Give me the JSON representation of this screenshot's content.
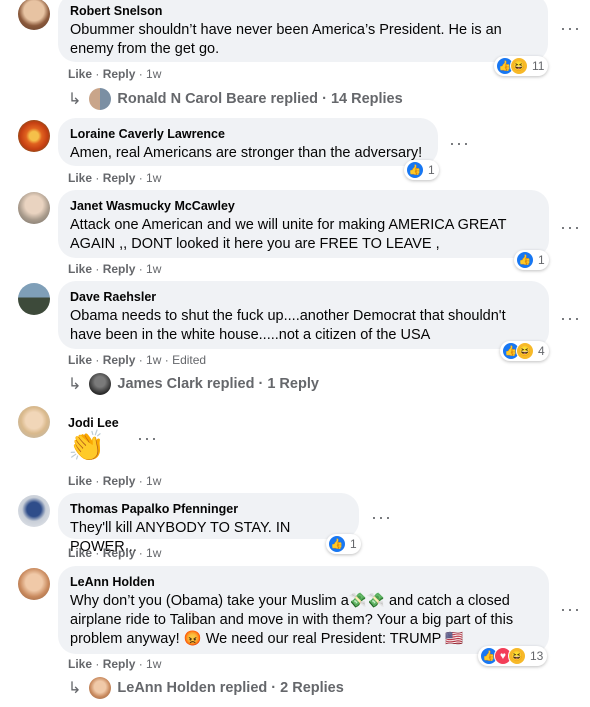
{
  "comments": [
    {
      "author": "Robert Snelson",
      "text": "Obummer shouldn’t have never been America’s President. He is an enemy from the get go.",
      "like": "Like",
      "reply": "Reply",
      "time": "1w",
      "reaction_count": "11",
      "replies": {
        "name": "Ronald N Carol Beare replied",
        "count": "14 Replies"
      }
    },
    {
      "author": "Loraine Caverly Lawrence",
      "text": "Amen, real Americans are stronger than the adversary!",
      "like": "Like",
      "reply": "Reply",
      "time": "1w",
      "reaction_count": "1"
    },
    {
      "author": "Janet Wasmucky McCawley",
      "text": "Attack one American and we will unite for making AMERICA GREAT AGAIN ,, DONT looked it here you are FREE TO LEAVE ,",
      "like": "Like",
      "reply": "Reply",
      "time": "1w",
      "reaction_count": "1"
    },
    {
      "author": "Dave Raehsler",
      "text": "Obama needs to shut the fuck up....another Democrat that shouldn't have been in the white house.....not a citizen of the USA",
      "like": "Like",
      "reply": "Reply",
      "time": "1w",
      "edited": "Edited",
      "reaction_count": "4",
      "replies": {
        "name": "James Clark replied",
        "count": "1 Reply"
      }
    },
    {
      "author": "Jodi Lee",
      "text": "👏",
      "like": "Like",
      "reply": "Reply",
      "time": "1w"
    },
    {
      "author": "Thomas Papalko Pfenninger",
      "text": "They'll kill ANYBODY TO STAY. IN POWER...",
      "like": "Like",
      "reply": "Reply",
      "time": "1w",
      "reaction_count": "1"
    },
    {
      "author": "LeAnn Holden",
      "text": "Why don’t you (Obama) take your Muslim a💸💸 and catch a closed airplane ride to Taliban and move in with them? Your a big part of this problem anyway! 😡 We need our real President: TRUMP 🇺🇸",
      "like": "Like",
      "reply": "Reply",
      "time": "1w",
      "reaction_count": "13",
      "replies": {
        "name": "LeAnn Holden replied",
        "count": "2 Replies"
      }
    }
  ],
  "colors": {
    "bubble": "#f0f2f5",
    "meta": "#65676b",
    "like_blue": "#1877f2",
    "haha_yellow": "#f7b928",
    "love_red": "#f33e58"
  },
  "icons": {
    "more": "more-dots-icon",
    "reply_arrow": "reply-arrow-icon",
    "like": "like-reaction-icon",
    "haha": "haha-reaction-icon",
    "love": "love-reaction-icon"
  }
}
